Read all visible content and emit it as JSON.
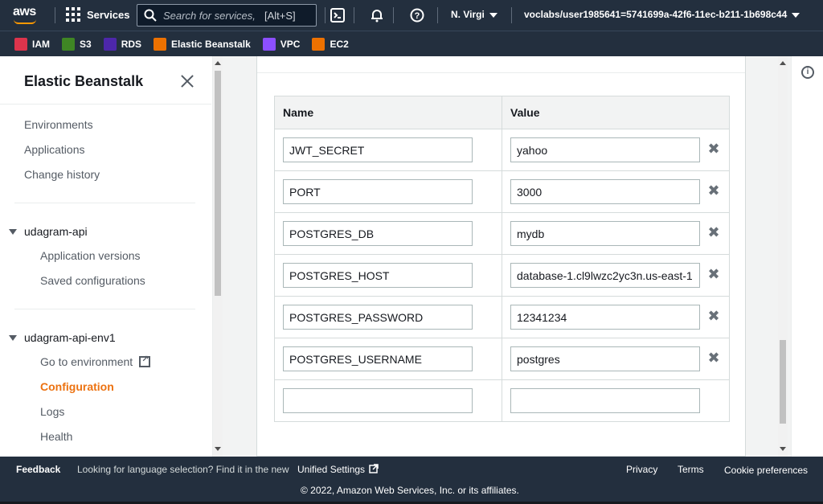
{
  "topnav": {
    "logo_text": "aws",
    "services_label": "Services",
    "search_placeholder": "Search for services,",
    "search_shortcut": "[Alt+S]",
    "user": "N. Virgi",
    "account": "voclabs/user1985641=5741699a-42f6-11ec-b211-1b698c44",
    "icons": [
      "cloudshell-icon",
      "bell-icon",
      "help-icon"
    ]
  },
  "favorites": [
    {
      "label": "IAM",
      "color": "#dd344c"
    },
    {
      "label": "S3",
      "color": "#3f8624"
    },
    {
      "label": "RDS",
      "color": "#4d27aa"
    },
    {
      "label": "Elastic Beanstalk",
      "color": "#ed7100"
    },
    {
      "label": "VPC",
      "color": "#8c4fff"
    },
    {
      "label": "EC2",
      "color": "#ed7100"
    }
  ],
  "sidebar": {
    "title": "Elastic Beanstalk",
    "top_links": [
      "Environments",
      "Applications",
      "Change history"
    ],
    "app": {
      "name": "udagram-api",
      "links": [
        "Application versions",
        "Saved configurations"
      ]
    },
    "env": {
      "name": "udagram-api-env1",
      "links": [
        "Go to environment",
        "Configuration",
        "Logs",
        "Health"
      ],
      "active": "Configuration"
    }
  },
  "table": {
    "headers": [
      "Name",
      "Value"
    ],
    "rows": [
      {
        "name": "JWT_SECRET",
        "value": "yahoo"
      },
      {
        "name": "PORT",
        "value": "3000"
      },
      {
        "name": "POSTGRES_DB",
        "value": "mydb"
      },
      {
        "name": "POSTGRES_HOST",
        "value": "database-1.cl9lwzc2yc3n.us-east-1"
      },
      {
        "name": "POSTGRES_PASSWORD",
        "value": "12341234"
      },
      {
        "name": "POSTGRES_USERNAME",
        "value": "postgres"
      }
    ],
    "empty_row": {
      "name": "",
      "value": ""
    }
  },
  "footer": {
    "feedback": "Feedback",
    "language_text": "Looking for language selection? Find it in the new",
    "unified_settings": "Unified Settings",
    "privacy": "Privacy",
    "terms": "Terms",
    "cookies": "Cookie preferences",
    "copyright": "© 2022, Amazon Web Services, Inc. or its affiliates."
  },
  "colors": {
    "nav_bg": "#232f3e",
    "accent_orange": "#ec7211",
    "border": "#d5dbdb"
  }
}
